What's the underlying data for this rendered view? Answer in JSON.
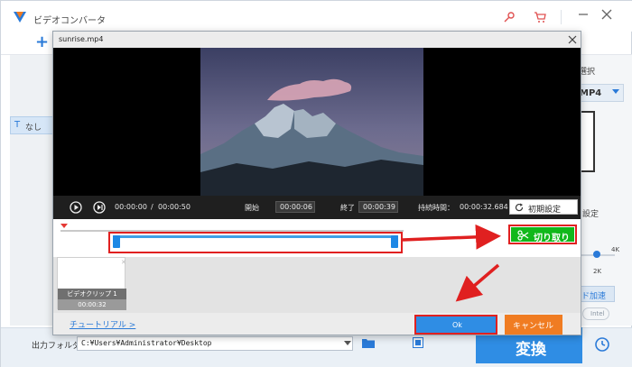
{
  "app": {
    "title": "ビデオコンバータ",
    "add_label": "+",
    "subtitle_none": "なし",
    "right_panel": {
      "output_format_label": "選択",
      "format_value": "MP4",
      "preset_resolutions": [
        "4K",
        "2K"
      ],
      "settings_label": "設定",
      "hw_accel_label": "ド加速",
      "intel_label": "Intel"
    },
    "output_folder_label": "出力フォルダ：",
    "output_folder_path": "C:¥Users¥Administrator¥Desktop",
    "convert_label": "変換"
  },
  "dialog": {
    "title": "sunrise.mp4",
    "playback": {
      "current_time": "00:00:00",
      "separator": "/",
      "total_time": "00:00:50"
    },
    "trim": {
      "start_label": "開始",
      "start_value": "00:00:06",
      "end_label": "終了",
      "end_value": "00:00:39",
      "duration_label": "持続時間：",
      "duration_value": "00:00:32.684",
      "reset_label": "初期設定"
    },
    "cut_label": "切り取り",
    "clip": {
      "name": "ビデオクリップ 1",
      "duration": "00:00:32"
    },
    "tutorial_label": "チュートリアル >",
    "ok_label": "Ok",
    "cancel_label": "キャンセル"
  },
  "colors": {
    "accent_blue": "#2f8de4",
    "cut_green": "#11b81b",
    "cancel_orange": "#f07c22",
    "highlight_red": "#e02020"
  }
}
